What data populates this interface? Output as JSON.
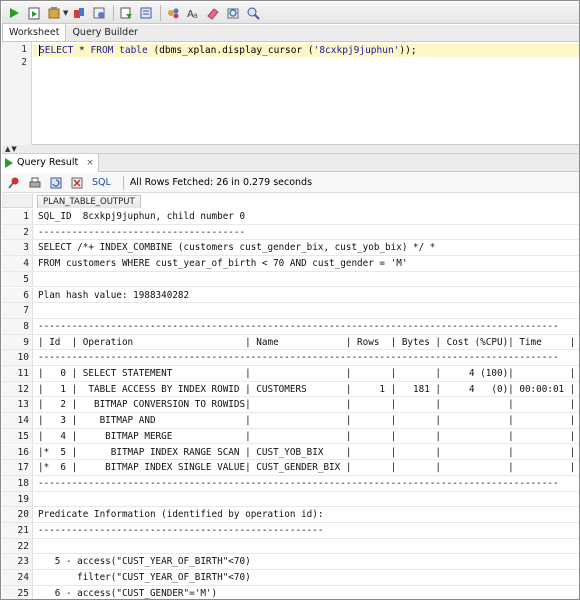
{
  "toolbar": {
    "icons": [
      "run-statement-icon",
      "run-script-icon",
      "commit-icon",
      "rollback-icon",
      "cancel-icon",
      "sql-tuning-icon",
      "explain-plan-icon",
      "autotrace-icon",
      "clear-icon",
      "history-icon",
      "format-icon",
      "find-icon"
    ]
  },
  "worksheet_tabs": [
    {
      "label": "Worksheet",
      "active": true
    },
    {
      "label": "Query Builder",
      "active": false
    }
  ],
  "editor": {
    "line_numbers": [
      "1",
      "2"
    ],
    "line1": {
      "kw_select": "SELECT",
      "star": " * ",
      "kw_from": "FROM",
      "space": " ",
      "kw_table": "table",
      "mid": " (dbms_xplan.display_cursor (",
      "literal": "'8cxkpj9juphun'",
      "end": "));"
    }
  },
  "result_tab": {
    "label": "Query Result",
    "close": "×"
  },
  "result_toolbar": {
    "sql_link": "SQL",
    "status": "All Rows Fetched: 26 in 0.279 seconds"
  },
  "grid": {
    "column_header": "PLAN_TABLE_OUTPUT",
    "rows": [
      {
        "n": "1",
        "text": "SQL_ID  8cxkpj9juphun, child number 0"
      },
      {
        "n": "2",
        "text": "-------------------------------------"
      },
      {
        "n": "3",
        "text": "SELECT /*+ INDEX_COMBINE (customers cust_gender_bix, cust_yob_bix) */ *"
      },
      {
        "n": "4",
        "text": "FROM customers WHERE cust_year_of_birth < 70 AND cust_gender = 'M'"
      },
      {
        "n": "5",
        "text": ""
      },
      {
        "n": "6",
        "text": "Plan hash value: 1988340282"
      },
      {
        "n": "7",
        "text": ""
      },
      {
        "n": "8",
        "text": "---------------------------------------------------------------------------------------------"
      },
      {
        "n": "9",
        "text": "| Id  | Operation                    | Name            | Rows  | Bytes | Cost (%CPU)| Time     |"
      },
      {
        "n": "10",
        "text": "---------------------------------------------------------------------------------------------"
      },
      {
        "n": "11",
        "text": "|   0 | SELECT STATEMENT             |                 |       |       |     4 (100)|          |"
      },
      {
        "n": "12",
        "text": "|   1 |  TABLE ACCESS BY INDEX ROWID | CUSTOMERS       |     1 |   181 |     4   (0)| 00:00:01 |"
      },
      {
        "n": "13",
        "text": "|   2 |   BITMAP CONVERSION TO ROWIDS|                 |       |       |            |          |"
      },
      {
        "n": "14",
        "text": "|   3 |    BITMAP AND                |                 |       |       |            |          |"
      },
      {
        "n": "15",
        "text": "|   4 |     BITMAP MERGE             |                 |       |       |            |          |"
      },
      {
        "n": "16",
        "text": "|*  5 |      BITMAP INDEX RANGE SCAN | CUST_YOB_BIX    |       |       |            |          |"
      },
      {
        "n": "17",
        "text": "|*  6 |     BITMAP INDEX SINGLE VALUE| CUST_GENDER_BIX |       |       |            |          |"
      },
      {
        "n": "18",
        "text": "---------------------------------------------------------------------------------------------"
      },
      {
        "n": "19",
        "text": ""
      },
      {
        "n": "20",
        "text": "Predicate Information (identified by operation id):"
      },
      {
        "n": "21",
        "text": "---------------------------------------------------"
      },
      {
        "n": "22",
        "text": ""
      },
      {
        "n": "23",
        "text": "   5 - access(\"CUST_YEAR_OF_BIRTH\"<70)"
      },
      {
        "n": "24",
        "text": "       filter(\"CUST_YEAR_OF_BIRTH\"<70)"
      },
      {
        "n": "25",
        "text": "   6 - access(\"CUST_GENDER\"='M')"
      }
    ]
  },
  "colors": {
    "current_line": "#fdf7c8",
    "keyword": "#1a1aa6",
    "run_green": "#2a9a2a"
  }
}
